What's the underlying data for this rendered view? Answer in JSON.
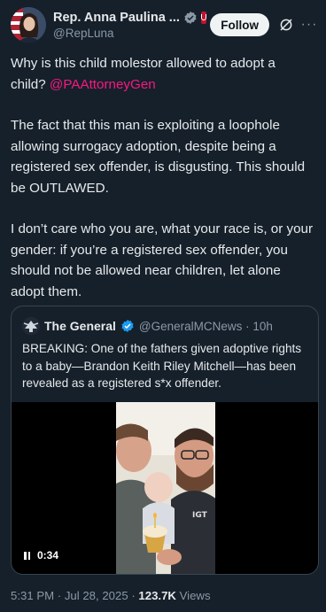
{
  "author": {
    "display_name": "Rep. Anna Paulina ...",
    "handle": "@RepLuna"
  },
  "header": {
    "follow_label": "Follow",
    "icons": [
      "verified-badge-icon",
      "government-badge-icon",
      "grok-icon",
      "more-icon"
    ]
  },
  "tweet": {
    "line1": "Why is this child molestor allowed to adopt a child? ",
    "mention": "@PAAttorneyGen",
    "paragraph2": "The fact that this man is exploiting a loophole allowing surrogacy adoption, despite being a registered sex offender, is disgusting. This should be OUTLAWED.",
    "paragraph3": "I don’t care who you are, what your race is, or your gender: if you’re a registered sex offender, you should not be allowed near children, let alone adopt them."
  },
  "quote": {
    "display_name": "The General",
    "handle_time": "@GeneralMCNews · 10h",
    "text": "BREAKING: One of the fathers given adoptive rights to a baby—Brandon Keith Riley Mitchell—has been revealed as a registered s*x offender.",
    "video": {
      "elapsed": "0:34"
    }
  },
  "meta": {
    "timestamp": "5:31 PM · Jul 28, 2025 · ",
    "views_count": "123.7K",
    "views_label": " Views"
  },
  "colors": {
    "background": "#15202b",
    "mention": "#f91880",
    "verified": "#1d9bf0",
    "secondary_text": "#8b98a5"
  }
}
